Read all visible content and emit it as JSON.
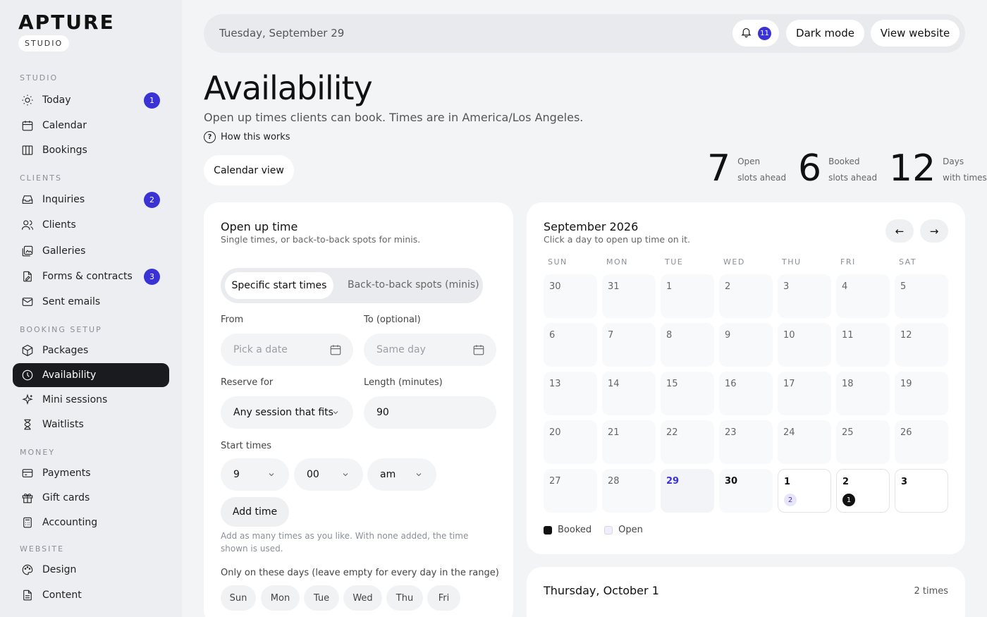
{
  "brand": {
    "logo": "APTURE",
    "tag": "STUDIO"
  },
  "sidebar": {
    "sections": [
      {
        "label": "STUDIO",
        "items": [
          {
            "label": "Today",
            "icon": "sun-icon",
            "badge": "1"
          },
          {
            "label": "Calendar",
            "icon": "calendar-icon",
            "badge": null
          },
          {
            "label": "Bookings",
            "icon": "columns-icon",
            "badge": null
          }
        ]
      },
      {
        "label": "CLIENTS",
        "items": [
          {
            "label": "Inquiries",
            "icon": "inbox-icon",
            "badge": "2"
          },
          {
            "label": "Clients",
            "icon": "users-icon",
            "badge": null
          },
          {
            "label": "Galleries",
            "icon": "gallery-icon",
            "badge": null
          },
          {
            "label": "Forms & contracts",
            "icon": "form-icon",
            "badge": "3"
          },
          {
            "label": "Sent emails",
            "icon": "mail-icon",
            "badge": null
          }
        ]
      },
      {
        "label": "BOOKING SETUP",
        "items": [
          {
            "label": "Packages",
            "icon": "package-icon",
            "badge": null
          },
          {
            "label": "Availability",
            "icon": "clock-icon",
            "badge": null,
            "active": true
          },
          {
            "label": "Mini sessions",
            "icon": "sparkle-icon",
            "badge": null
          },
          {
            "label": "Waitlists",
            "icon": "hourglass-icon",
            "badge": null
          }
        ]
      },
      {
        "label": "MONEY",
        "items": [
          {
            "label": "Payments",
            "icon": "card-icon",
            "badge": null
          },
          {
            "label": "Gift cards",
            "icon": "gift-icon",
            "badge": null
          },
          {
            "label": "Accounting",
            "icon": "calculator-icon",
            "badge": null
          }
        ]
      },
      {
        "label": "WEBSITE",
        "items": [
          {
            "label": "Design",
            "icon": "palette-icon",
            "badge": null
          },
          {
            "label": "Content",
            "icon": "document-icon",
            "badge": null
          }
        ]
      }
    ]
  },
  "topbar": {
    "date": "Tuesday, September 29",
    "notifications": "11",
    "dark_mode": "Dark mode",
    "view_website": "View website"
  },
  "page": {
    "title": "Availability",
    "subtitle": "Open up times clients can book. Times are in America/Los Angeles.",
    "how": "How this works",
    "calendar_view": "Calendar view",
    "stats": [
      {
        "value": "7",
        "line1": "Open",
        "line2": "slots ahead"
      },
      {
        "value": "6",
        "line1": "Booked",
        "line2": "slots ahead"
      },
      {
        "value": "12",
        "line1": "Days",
        "line2": "with times"
      }
    ]
  },
  "form": {
    "title": "Open up time",
    "subtitle": "Single times, or back-to-back spots for minis.",
    "mode_a": "Specific start times",
    "mode_b": "Back-to-back spots (minis)",
    "from_label": "From",
    "from_placeholder": "Pick a date",
    "to_label": "To (optional)",
    "to_placeholder": "Same day",
    "reserve_label": "Reserve for",
    "reserve_value": "Any session that fits",
    "length_label": "Length (minutes)",
    "length_value": "90",
    "start_label": "Start times",
    "hour": "9",
    "minute": "00",
    "ampm": "am",
    "add_time": "Add time",
    "help": "Add as many times as you like. With none added, the time shown is used.",
    "days_label": "Only on these days (leave empty for every day in the range)",
    "days": [
      "Sun",
      "Mon",
      "Tue",
      "Wed",
      "Thu",
      "Fri"
    ]
  },
  "calendar": {
    "month": "September 2026",
    "hint": "Click a day to open up time on it.",
    "dow": [
      "SUN",
      "MON",
      "TUE",
      "WED",
      "THU",
      "FRI",
      "SAT"
    ],
    "weeks": [
      [
        "30",
        "31",
        "1",
        "2",
        "3",
        "4",
        "5"
      ],
      [
        "6",
        "7",
        "8",
        "9",
        "10",
        "11",
        "12"
      ],
      [
        "13",
        "14",
        "15",
        "16",
        "17",
        "18",
        "19"
      ],
      [
        "20",
        "21",
        "22",
        "23",
        "24",
        "25",
        "26"
      ],
      [
        "27",
        "28",
        "29",
        "30",
        "1",
        "2",
        "3"
      ]
    ],
    "oct1_open": "2",
    "oct2_booked": "1",
    "legend_booked": "Booked",
    "legend_open": "Open",
    "colors": {
      "accent": "#3b32d6",
      "booked": "#111111",
      "open_bg": "#e7e5f7"
    }
  },
  "day_panel": {
    "title": "Thursday, October 1",
    "count": "2 times"
  }
}
